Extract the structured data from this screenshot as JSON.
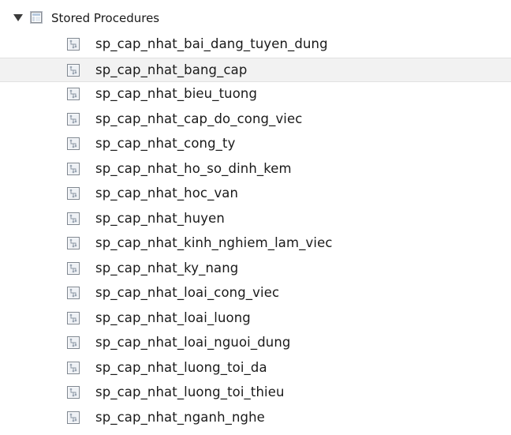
{
  "tree": {
    "section": {
      "label": "Stored Procedures",
      "expanded": true,
      "toggle_icon": "triangle-down-icon",
      "icon": "stored-procedures-folder-icon"
    },
    "item_icon": "stored-procedure-icon",
    "selected_index": 1,
    "items": [
      {
        "label": "sp_cap_nhat_bai_dang_tuyen_dung"
      },
      {
        "label": "sp_cap_nhat_bang_cap"
      },
      {
        "label": "sp_cap_nhat_bieu_tuong"
      },
      {
        "label": "sp_cap_nhat_cap_do_cong_viec"
      },
      {
        "label": "sp_cap_nhat_cong_ty"
      },
      {
        "label": "sp_cap_nhat_ho_so_dinh_kem"
      },
      {
        "label": "sp_cap_nhat_hoc_van"
      },
      {
        "label": "sp_cap_nhat_huyen"
      },
      {
        "label": "sp_cap_nhat_kinh_nghiem_lam_viec"
      },
      {
        "label": "sp_cap_nhat_ky_nang"
      },
      {
        "label": "sp_cap_nhat_loai_cong_viec"
      },
      {
        "label": "sp_cap_nhat_loai_luong"
      },
      {
        "label": "sp_cap_nhat_loai_nguoi_dung"
      },
      {
        "label": "sp_cap_nhat_luong_toi_da"
      },
      {
        "label": "sp_cap_nhat_luong_toi_thieu"
      },
      {
        "label": "sp_cap_nhat_nganh_nghe"
      }
    ],
    "colors": {
      "selected_row_background": "#f2f2f2",
      "text": "#1a1a1a",
      "icon_border": "#7f8790"
    }
  }
}
